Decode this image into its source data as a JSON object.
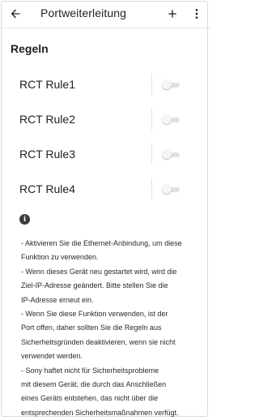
{
  "appbar": {
    "title": "Portweiterleitung",
    "back_icon": "arrow-back-icon",
    "add_icon": "plus-icon",
    "more_icon": "more-vert-icon"
  },
  "section": {
    "title": "Regeln"
  },
  "rules": [
    {
      "label": "RCT Rule1",
      "enabled": false
    },
    {
      "label": "RCT Rule2",
      "enabled": false
    },
    {
      "label": "RCT Rule3",
      "enabled": false
    },
    {
      "label": "RCT Rule4",
      "enabled": false
    }
  ],
  "info": {
    "icon": "info-icon",
    "icon_glyph": "i",
    "lines": [
      "- Aktivieren Sie die Ethernet-Anbindung, um diese",
      "Funktion zu verwenden.",
      "- Wenn dieses Gerät neu gestartet wird, wird die",
      "Ziel-IP-Adresse geändert. Bitte stellen Sie die",
      "IP-Adresse erneut ein.",
      "- Wenn Sie diese Funktion verwenden, ist der",
      "Port offen, daher sollten Sie die Regeln aus",
      "Sicherheitsgründen deaktivieren, wenn sie nicht",
      "verwendet werden.",
      "- Sony haftet nicht für Sicherheitsprobleme",
      "mit diesem Gerät, die durch das Anschließen",
      "eines Geräts entstehen, das nicht über die",
      "entsprechenden Sicherheitsmaßnahmen verfügt."
    ]
  }
}
